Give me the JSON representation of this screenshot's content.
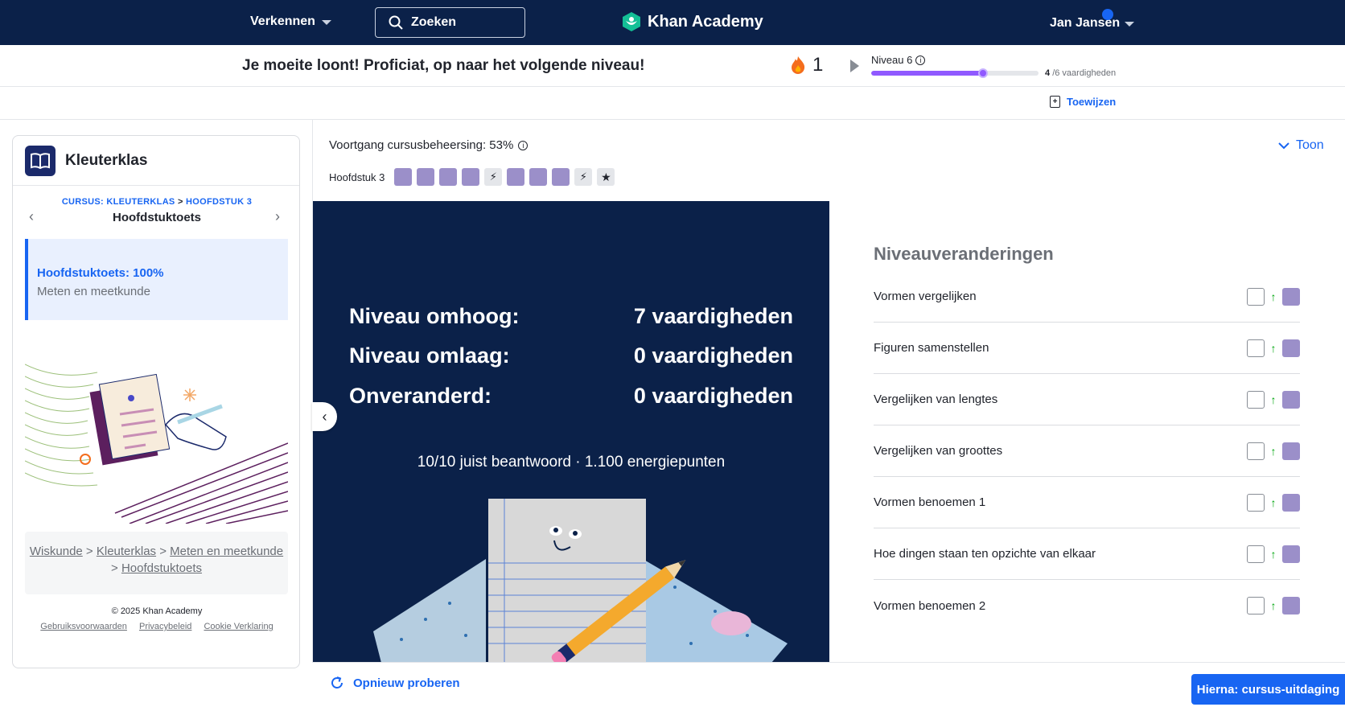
{
  "nav": {
    "explore": "Verkennen",
    "search_label": "Zoeken",
    "logo_text": "Khan Academy",
    "user_name": "Jan Jansen"
  },
  "status": {
    "message": "Je moeite loont! Proficiat, op naar het volgende niveau!",
    "streak": "1",
    "level_label": "Niveau 6",
    "level_progress": 0.67,
    "skills_done": "4",
    "skills_total": "/6 vaardigheden"
  },
  "assign": {
    "label": "Toewijzen"
  },
  "sidebar": {
    "course_title": "Kleuterklas",
    "crumb_course": "CURSUS: KLEUTERKLAS",
    "crumb_sep": ">",
    "crumb_chapter": "HOOFDSTUK 3",
    "crumb_title": "Hoofdstuktoets",
    "active_title": "Hoofdstuktoets: 100%",
    "active_sub": "Meten en meetkunde",
    "path": [
      "Wiskunde",
      "Kleuterklas",
      "Meten en meetkunde",
      "Hoofdstuktoets"
    ],
    "path_sep": ">",
    "copyright": "© 2025 Khan Academy",
    "links": [
      "Gebruiksvoorwaarden",
      "Privacybeleid",
      "Cookie Verklaring"
    ]
  },
  "main": {
    "progress_title": "Voortgang cursusbeheersing: 53%",
    "toon_label": "Toon",
    "chapter_label": "Hoofdstuk 3",
    "results": [
      {
        "label": "Niveau omhoog:",
        "value": "7 vaardigheden"
      },
      {
        "label": "Niveau omlaag:",
        "value": "0 vaardigheden"
      },
      {
        "label": "Onveranderd:",
        "value": "0 vaardigheden"
      }
    ],
    "summary": "10/10 juist beantwoord · 1.100 energiepunten",
    "changes_title": "Niveauveranderingen",
    "changes": [
      "Vormen vergelijken",
      "Figuren samenstellen",
      "Vergelijken van lengtes",
      "Vergelijken van groottes",
      "Vormen benoemen 1",
      "Hoe dingen staan ten opzichte van elkaar",
      "Vormen benoemen 2"
    ],
    "retry_label": "Opnieuw proberen",
    "next_label": "Hierna: cursus-uitdaging"
  },
  "colors": {
    "nav_bg": "#0b2149",
    "accent": "#1865f2",
    "mastery": "#9b8fc9",
    "level_bar": "#9059ff",
    "up_arrow": "#00a60e"
  }
}
